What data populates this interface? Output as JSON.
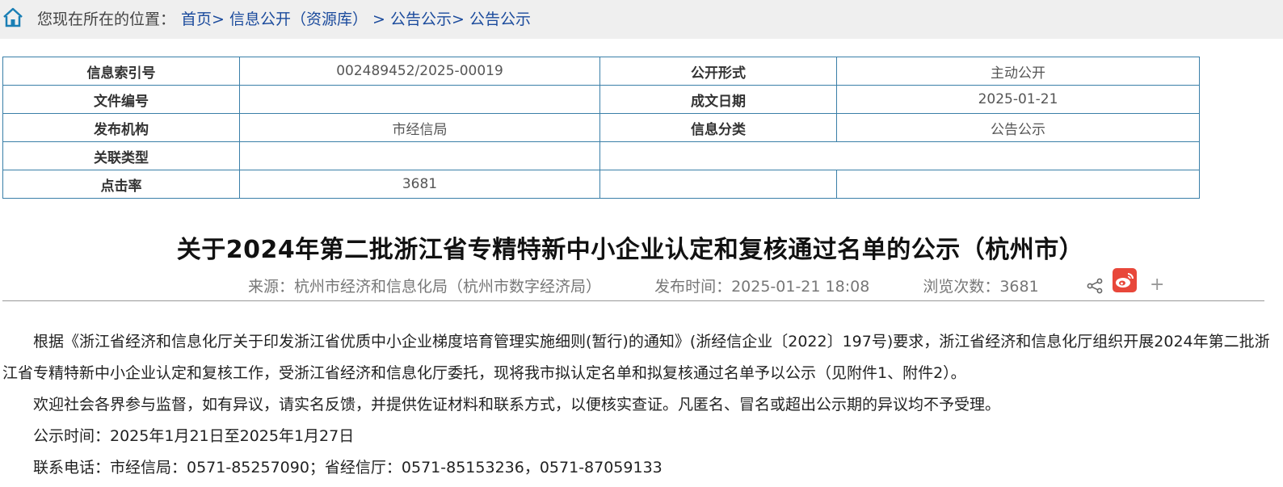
{
  "breadcrumb": {
    "label": "您现在所在的位置：",
    "items": [
      "首页",
      "信息公开（资源库）",
      "公告公示",
      "公告公示"
    ],
    "separators": [
      ">",
      " > ",
      ">"
    ]
  },
  "meta_table": {
    "rows": [
      [
        "信息索引号",
        "002489452/2025-00019",
        "公开形式",
        "主动公开"
      ],
      [
        "文件编号",
        "",
        "成文日期",
        "2025-01-21"
      ],
      [
        "发布机构",
        "市经信局",
        "信息分类",
        "公告公示"
      ],
      [
        "关联类型",
        "",
        "",
        ""
      ],
      [
        "点击率",
        "3681",
        "",
        ""
      ]
    ]
  },
  "article": {
    "title": "关于2024年第二批浙江省专精特新中小企业认定和复核通过名单的公示（杭州市）",
    "source": "来源：杭州市经济和信息化局（杭州市数字经济局）",
    "publish_time": "发布时间：2025-01-21 18:08",
    "views": "浏览次数：3681",
    "paragraphs": [
      "根据《浙江省经济和信息化厅关于印发浙江省优质中小企业梯度培育管理实施细则(暂行)的通知》(浙经信企业〔2022〕197号)要求，浙江省经济和信息化厅组织开展2024年第二批浙江省专精特新中小企业认定和复核工作，受浙江省经济和信息化厅委托，现将我市拟认定名单和拟复核通过名单予以公示（见附件1、附件2）。",
      "欢迎社会各界参与监督，如有异议，请实名反馈，并提供佐证材料和联系方式，以便核实查证。凡匿名、冒名或超出公示期的异议均不予受理。",
      "公示时间：2025年1月21日至2025年1月27日",
      "联系电话：市经信局：0571-85257090；省经信厅：0571-85153236，0571-87059133"
    ]
  },
  "icons": {
    "home": "home-icon",
    "share": "share-icon",
    "weibo": "weibo-icon",
    "plus": "plus-icon"
  },
  "colors": {
    "link": "#1a4a9c",
    "table_border": "#3a7fa8",
    "weibo_red": "#e8473a"
  }
}
